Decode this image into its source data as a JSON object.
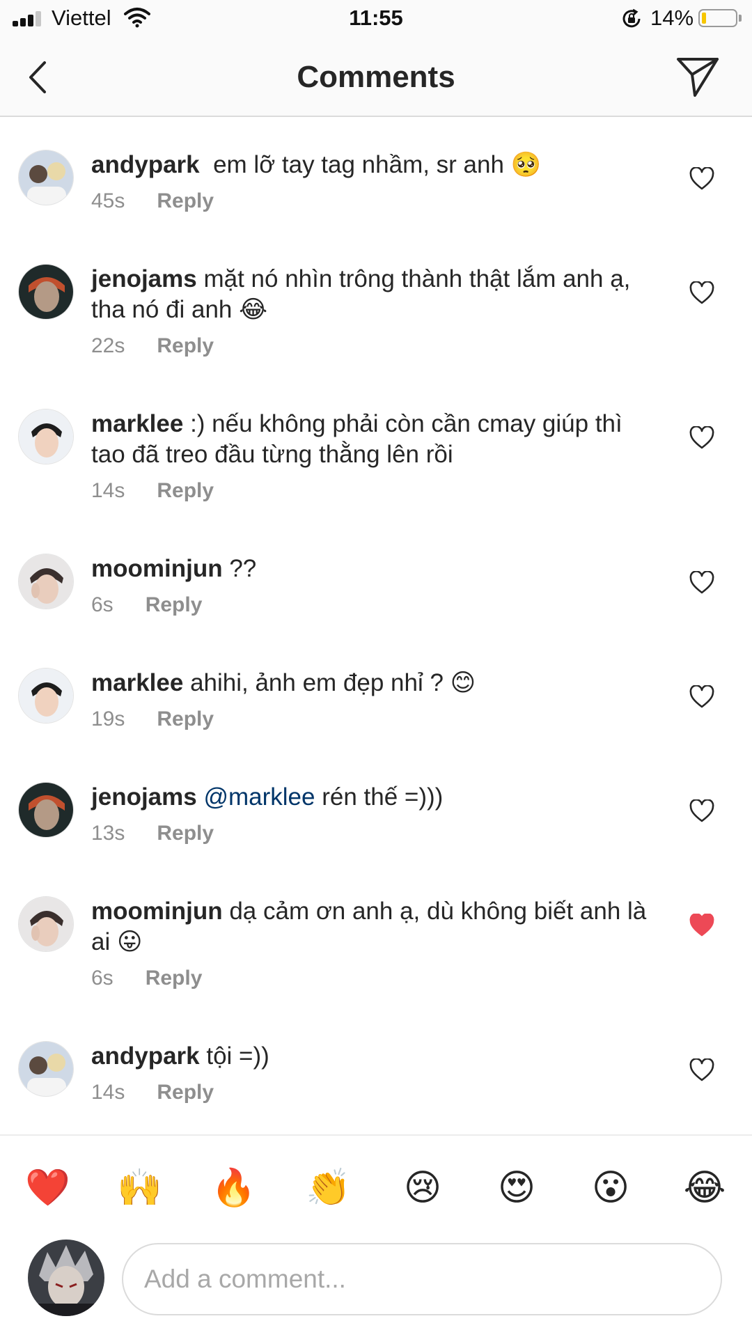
{
  "status_bar": {
    "carrier": "Viettel",
    "time": "11:55",
    "battery_percent": "14%",
    "battery_level": 0.14,
    "battery_color": "#f7c600"
  },
  "header": {
    "title": "Comments",
    "back_icon": "chevron-left-icon",
    "send_icon": "paper-plane-icon"
  },
  "comments": [
    {
      "username": "andypark",
      "text": "em lỡ tay tag nhầm, sr anh 🥺",
      "time": "45s",
      "reply": "Reply",
      "liked": false
    },
    {
      "username": "jenojams",
      "text": "mặt nó nhìn trông thành thật lắm anh ạ, tha nó đi anh 😂",
      "time": "22s",
      "reply": "Reply",
      "liked": false
    },
    {
      "username": "marklee",
      "text": ":) nếu không phải còn cần cmay giúp thì tao đã treo đầu từng thằng lên rồi",
      "time": "14s",
      "reply": "Reply",
      "liked": false
    },
    {
      "username": "moominjun",
      "text": "??",
      "time": "6s",
      "reply": "Reply",
      "liked": false
    },
    {
      "username": "marklee",
      "text": "ahihi, ảnh em đẹp nhỉ ? 😊",
      "time": "19s",
      "reply": "Reply",
      "liked": false
    },
    {
      "username": "jenojams",
      "mention": "@marklee",
      "text": "rén thế =)))",
      "time": "13s",
      "reply": "Reply",
      "liked": false
    },
    {
      "username": "moominjun",
      "text": "dạ cảm ơn anh ạ, dù không biết anh là ai 😛",
      "time": "6s",
      "reply": "Reply",
      "liked": true
    },
    {
      "username": "andypark",
      "text": "tội =))",
      "time": "14s",
      "reply": "Reply",
      "liked": false
    }
  ],
  "reactions": [
    "❤️",
    "🙌",
    "🔥",
    "👏",
    "😢",
    "😍",
    "😮",
    "😂"
  ],
  "composer": {
    "placeholder": "Add a comment..."
  },
  "colors": {
    "like_active": "#ed4956",
    "icon_inactive": "#262626",
    "secondary_text": "#8e8e8e",
    "mention": "#003569"
  }
}
